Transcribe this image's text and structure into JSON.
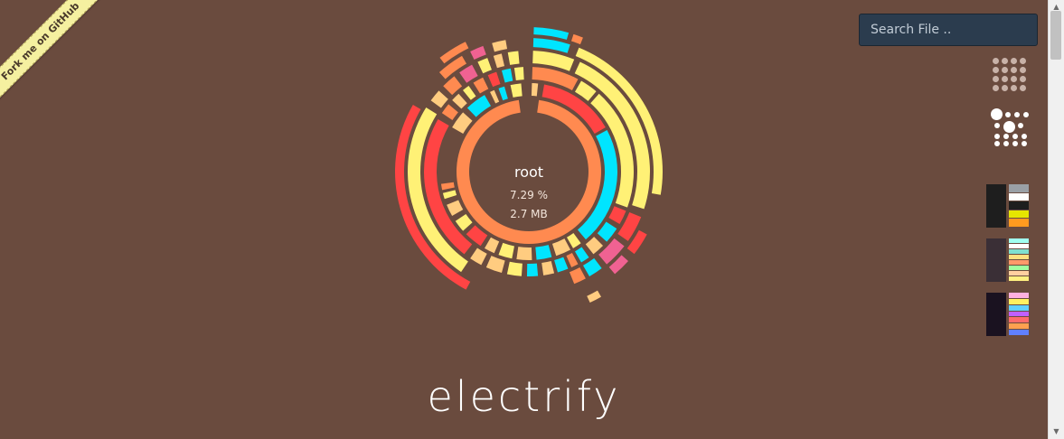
{
  "ribbon": {
    "label": "Fork me on GitHub"
  },
  "center": {
    "name": "root",
    "percent": "7.29 %",
    "size": "2.7 MB"
  },
  "app": {
    "title": "electrify"
  },
  "search": {
    "placeholder": "Search File .."
  },
  "colors": {
    "background": "#6a4b3e",
    "palette": [
      "#ff4444",
      "#fff176",
      "#ff8a50",
      "#00e5ff",
      "#ffcc80",
      "#f06292"
    ]
  },
  "layout_buttons": [
    {
      "name": "flat-grid-layout",
      "icon": "dot-grid-icon"
    },
    {
      "name": "clustered-grid-layout",
      "icon": "cluster-grid-icon"
    }
  ],
  "themes": [
    {
      "name": "dark-grey",
      "bg": "#1e1e1e",
      "swatches": [
        "#9aa0a6",
        "#ffffff",
        "#1e1e1e",
        "#e6e600",
        "#ff9a1f"
      ]
    },
    {
      "name": "plum",
      "bg": "#3a2f36",
      "swatches": [
        "#a0fff0",
        "#ffffff",
        "#80e0d0",
        "#ffe080",
        "#ff9a6a",
        "#a0ffa0",
        "#ffd0a0",
        "#fff080"
      ]
    },
    {
      "name": "midnight",
      "bg": "#1a1220",
      "swatches": [
        "#ffb0e0",
        "#fff060",
        "#60d0ff",
        "#c060ff",
        "#ff6a6a",
        "#ffa050",
        "#6080ff"
      ]
    }
  ],
  "sunburst_rings": [
    {
      "r0": 66,
      "r1": 80,
      "segments": [
        {
          "a0": 8,
          "a1": 352,
          "c": "#ff8a50"
        }
      ]
    },
    {
      "r0": 84,
      "r1": 98,
      "segments": [
        {
          "a0": 2,
          "a1": 6,
          "c": "#ffcc80"
        },
        {
          "a0": 10,
          "a1": 60,
          "c": "#ff4444"
        },
        {
          "a0": 62,
          "a1": 140,
          "c": "#00e5ff"
        },
        {
          "a0": 144,
          "a1": 150,
          "c": "#fff176"
        },
        {
          "a0": 152,
          "a1": 162,
          "c": "#ffcc80"
        },
        {
          "a0": 165,
          "a1": 175,
          "c": "#00e5ff"
        },
        {
          "a0": 178,
          "a1": 188,
          "c": "#ffcc80"
        },
        {
          "a0": 191,
          "a1": 200,
          "c": "#fff176"
        },
        {
          "a0": 203,
          "a1": 210,
          "c": "#ffcc80"
        },
        {
          "a0": 213,
          "a1": 225,
          "c": "#ff4444"
        },
        {
          "a0": 228,
          "a1": 236,
          "c": "#fff176"
        },
        {
          "a0": 240,
          "a1": 248,
          "c": "#ffcc80"
        },
        {
          "a0": 252,
          "a1": 256,
          "c": "#fff176"
        },
        {
          "a0": 258,
          "a1": 262,
          "c": "#ff8a50"
        },
        {
          "a0": 300,
          "a1": 312,
          "c": "#ffcc80"
        },
        {
          "a0": 316,
          "a1": 330,
          "c": "#00e5ff"
        },
        {
          "a0": 334,
          "a1": 337,
          "c": "#ffcc80"
        },
        {
          "a0": 340,
          "a1": 344,
          "c": "#00e5ff"
        },
        {
          "a0": 348,
          "a1": 355,
          "c": "#fff176"
        }
      ]
    },
    {
      "r0": 102,
      "r1": 116,
      "segments": [
        {
          "a0": 2,
          "a1": 28,
          "c": "#ff8a50"
        },
        {
          "a0": 30,
          "a1": 40,
          "c": "#fff176"
        },
        {
          "a0": 42,
          "a1": 110,
          "c": "#fff176"
        },
        {
          "a0": 112,
          "a1": 120,
          "c": "#ff4444"
        },
        {
          "a0": 123,
          "a1": 132,
          "c": "#00e5ff"
        },
        {
          "a0": 135,
          "a1": 142,
          "c": "#ffcc80"
        },
        {
          "a0": 145,
          "a1": 150,
          "c": "#00e5ff"
        },
        {
          "a0": 152,
          "a1": 156,
          "c": "#ff8a50"
        },
        {
          "a0": 158,
          "a1": 164,
          "c": "#00e5ff"
        },
        {
          "a0": 166,
          "a1": 172,
          "c": "#ffcc80"
        },
        {
          "a0": 175,
          "a1": 181,
          "c": "#00e5ff"
        },
        {
          "a0": 184,
          "a1": 192,
          "c": "#fff176"
        },
        {
          "a0": 195,
          "a1": 204,
          "c": "#ffcc80"
        },
        {
          "a0": 207,
          "a1": 214,
          "c": "#ffcc80"
        },
        {
          "a0": 218,
          "a1": 300,
          "c": "#ff4444"
        },
        {
          "a0": 304,
          "a1": 310,
          "c": "#ff8a50"
        },
        {
          "a0": 313,
          "a1": 318,
          "c": "#ffcc80"
        },
        {
          "a0": 321,
          "a1": 325,
          "c": "#fff176"
        },
        {
          "a0": 328,
          "a1": 334,
          "c": "#ff8a50"
        },
        {
          "a0": 337,
          "a1": 342,
          "c": "#ff4444"
        },
        {
          "a0": 345,
          "a1": 350,
          "c": "#00e5ff"
        },
        {
          "a0": 352,
          "a1": 357,
          "c": "#fff176"
        }
      ]
    },
    {
      "r0": 120,
      "r1": 134,
      "segments": [
        {
          "a0": 2,
          "a1": 22,
          "c": "#fff176"
        },
        {
          "a0": 25,
          "a1": 108,
          "c": "#fff176"
        },
        {
          "a0": 112,
          "a1": 125,
          "c": "#ff4444"
        },
        {
          "a0": 128,
          "a1": 140,
          "c": "#f06292"
        },
        {
          "a0": 143,
          "a1": 150,
          "c": "#00e5ff"
        },
        {
          "a0": 152,
          "a1": 158,
          "c": "#ff8a50"
        },
        {
          "a0": 214,
          "a1": 302,
          "c": "#fff176"
        },
        {
          "a0": 306,
          "a1": 312,
          "c": "#ffcc80"
        },
        {
          "a0": 315,
          "a1": 322,
          "c": "#ff8a50"
        },
        {
          "a0": 325,
          "a1": 332,
          "c": "#f06292"
        },
        {
          "a0": 335,
          "a1": 340,
          "c": "#fff176"
        },
        {
          "a0": 343,
          "a1": 347,
          "c": "#ffcc80"
        },
        {
          "a0": 350,
          "a1": 355,
          "c": "#fff176"
        }
      ]
    },
    {
      "r0": 138,
      "r1": 148,
      "segments": [
        {
          "a0": 2,
          "a1": 18,
          "c": "#00e5ff"
        },
        {
          "a0": 22,
          "a1": 100,
          "c": "#fff176"
        },
        {
          "a0": 118,
          "a1": 128,
          "c": "#ff4444"
        },
        {
          "a0": 132,
          "a1": 140,
          "c": "#f06292"
        },
        {
          "a0": 208,
          "a1": 300,
          "c": "#ff4444"
        },
        {
          "a0": 318,
          "a1": 330,
          "c": "#ff8a50"
        },
        {
          "a0": 334,
          "a1": 340,
          "c": "#f06292"
        },
        {
          "a0": 344,
          "a1": 350,
          "c": "#ffcc80"
        }
      ]
    },
    {
      "r0": 152,
      "r1": 160,
      "segments": [
        {
          "a0": 2,
          "a1": 16,
          "c": "#00e5ff"
        },
        {
          "a0": 18,
          "a1": 22,
          "c": "#ff8a50"
        },
        {
          "a0": 150,
          "a1": 155,
          "c": "#ffcc80"
        },
        {
          "a0": 322,
          "a1": 334,
          "c": "#ff8a50"
        }
      ]
    }
  ]
}
